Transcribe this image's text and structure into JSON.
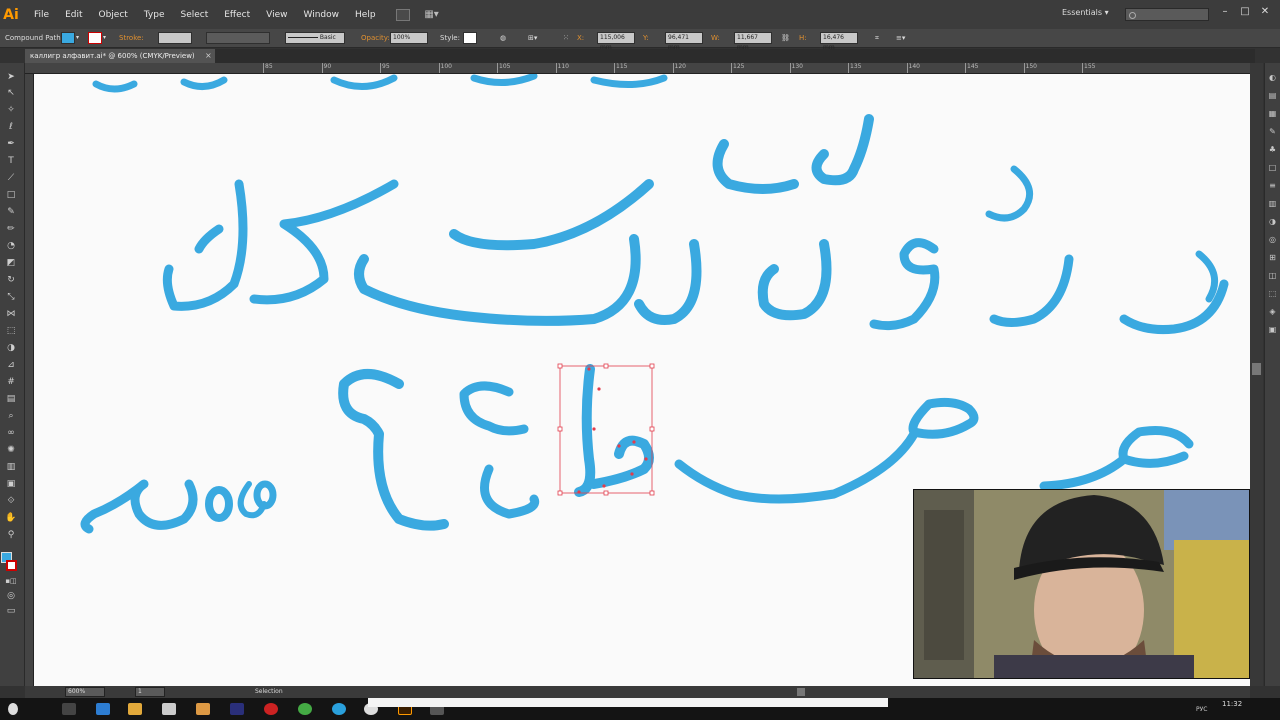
{
  "menubar": {
    "app_logo": "Ai",
    "items": [
      "File",
      "Edit",
      "Object",
      "Type",
      "Select",
      "Effect",
      "View",
      "Window",
      "Help"
    ],
    "workspace": "Essentials",
    "window_controls": [
      "–",
      "□",
      "✕"
    ]
  },
  "controlbar": {
    "selection_type": "Compound Path",
    "stroke_label": "Stroke:",
    "brush_label": "Basic",
    "opacity_label": "Opacity:",
    "opacity_value": "100%",
    "style_label": "Style:",
    "x_label": "X:",
    "x_value": "115,006 mm",
    "y_label": "Y:",
    "y_value": "96,471 mm",
    "w_label": "W:",
    "w_value": "11,667 mm",
    "h_label": "H:",
    "h_value": "16,476 mm"
  },
  "document": {
    "tab_title": "каллигр алфавит.ai* @ 600% (CMYK/Preview)",
    "tab_close": "×"
  },
  "ruler": {
    "labels": [
      "85",
      "90",
      "95",
      "100",
      "105",
      "110",
      "115",
      "120",
      "125",
      "130",
      "135",
      "140",
      "145",
      "150",
      "155"
    ]
  },
  "statusbar": {
    "zoom": "600%",
    "page": "1",
    "tool": "Selection"
  },
  "taskbar": {
    "lang": "РУС",
    "time": "11:32"
  },
  "colors": {
    "accent": "#3aa9e0",
    "selection": "#e23c4c"
  },
  "icons": {
    "tools": [
      "selection-tool-icon",
      "direct-selection-tool-icon",
      "magic-wand-icon",
      "lasso-icon",
      "pen-tool-icon",
      "type-tool-icon",
      "line-tool-icon",
      "rectangle-tool-icon",
      "paintbrush-icon",
      "pencil-icon",
      "blob-brush-icon",
      "eraser-icon",
      "rotate-icon",
      "scale-icon",
      "width-tool-icon",
      "free-transform-icon",
      "shape-builder-icon",
      "perspective-grid-icon",
      "mesh-icon",
      "gradient-icon",
      "eyedropper-icon",
      "blend-icon",
      "symbol-sprayer-icon",
      "column-graph-icon",
      "artboard-icon",
      "slice-icon",
      "hand-icon",
      "zoom-icon"
    ]
  }
}
